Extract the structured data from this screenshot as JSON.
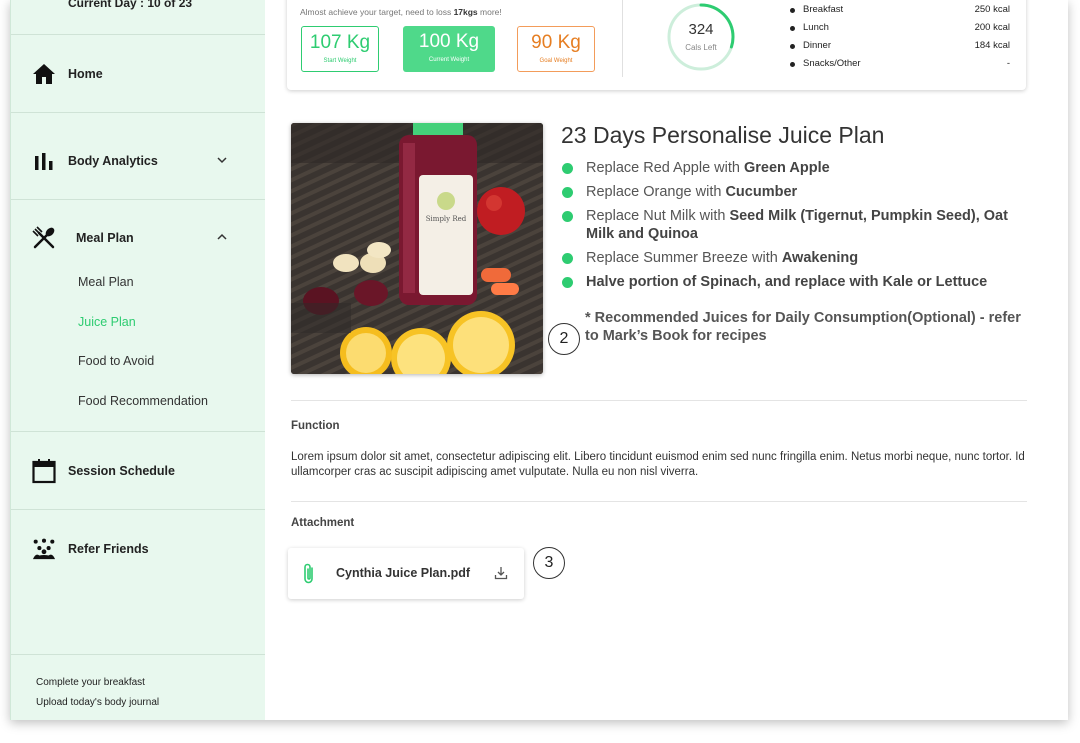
{
  "sidebar": {
    "current_day": "Current Day : 10 of 23",
    "nav": {
      "home": "Home",
      "body_analytics": "Body Analytics",
      "meal_plan": "Meal Plan",
      "session_schedule": "Session Schedule",
      "refer_friends": "Refer Friends"
    },
    "meal_sub": [
      "Meal Plan",
      "Juice Plan",
      "Food to Avoid",
      "Food Recommendation"
    ],
    "footer": [
      "Complete your breakfast",
      "Upload today's body journal"
    ]
  },
  "summary": {
    "hint_prefix": "Almost achieve your target, need to loss ",
    "hint_bold": "17kgs",
    "hint_suffix": " more!",
    "start_weight": {
      "value": "107 Kg",
      "label": "Start Weight"
    },
    "current_weight": {
      "value": "100 Kg",
      "label": "Current Weight"
    },
    "goal_weight": {
      "value": "90 Kg",
      "label": "Goal Weight"
    },
    "calories": {
      "value": "324",
      "label": "Cals Left"
    },
    "meals": [
      {
        "name": "Breakfast",
        "kcal": "250 kcal"
      },
      {
        "name": "Lunch",
        "kcal": "200 kcal"
      },
      {
        "name": "Dinner",
        "kcal": "184 kcal"
      },
      {
        "name": "Snacks/Other",
        "kcal": "-"
      }
    ]
  },
  "plan": {
    "title": "23 Days Personalise Juice Plan",
    "items": [
      {
        "pre": "Replace Red Apple with ",
        "bold": "Green Apple"
      },
      {
        "pre": "Replace Orange with ",
        "bold": "Cucumber"
      },
      {
        "pre": "Replace Nut Milk with ",
        "bold": "Seed Milk (Tigernut, Pumpkin Seed), Oat Milk and Quinoa"
      },
      {
        "pre": "Replace Summer Breeze with ",
        "bold": "Awakening"
      },
      {
        "pre": "",
        "bold": "Halve portion of Spinach, and replace with Kale or Lettuce"
      }
    ],
    "note": "* Recommended Juices for Daily Consumption(Optional) - refer to Mark’s Book for recipes",
    "markers": [
      "2",
      "3"
    ]
  },
  "function": {
    "heading": "Function",
    "body": "Lorem ipsum dolor sit amet, consectetur adipiscing elit. Libero tincidunt euismod enim sed nunc fringilla enim. Netus morbi neque, nunc tortor. Id ullamcorper cras ac suscipit adipiscing amet vulputate. Nulla eu non nisl viverra."
  },
  "attachment": {
    "heading": "Attachment",
    "file_name": "Cynthia Juice Plan.pdf"
  },
  "bottle_label": "Simply Red",
  "colors": {
    "accent": "#2ecc71",
    "sidebar_bg": "#e8f8ee",
    "goal": "#e67e22"
  },
  "cal_progress": 0.3
}
